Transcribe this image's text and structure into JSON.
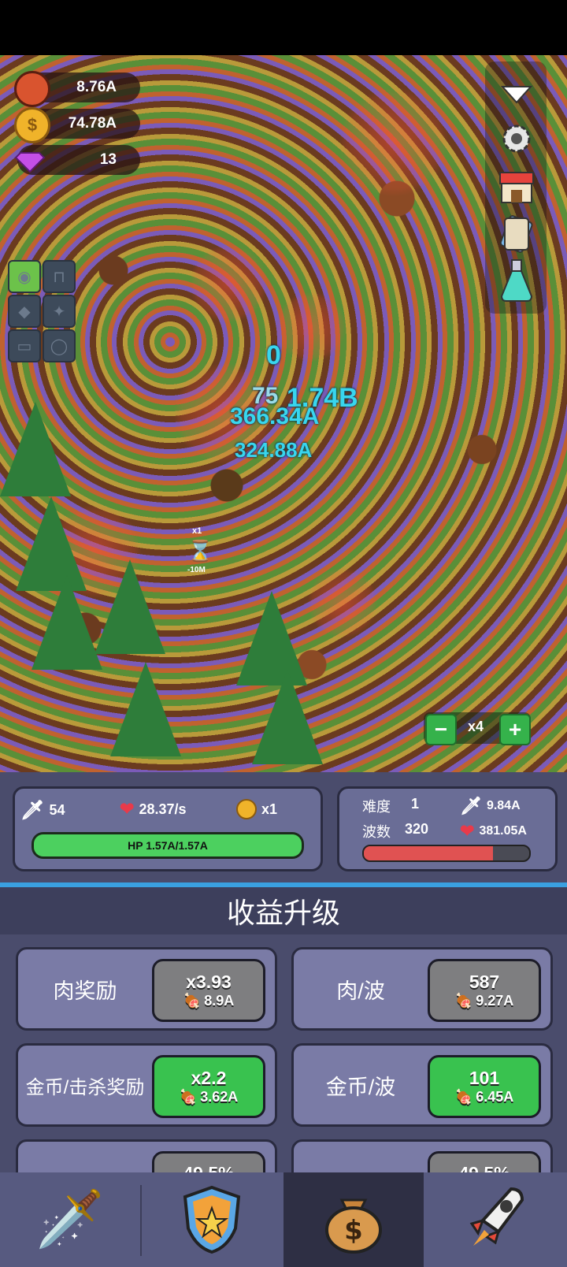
{
  "resources": {
    "meat": "8.76A",
    "gold": "74.78A",
    "gems": "13"
  },
  "floating_numbers": [
    "0",
    "75",
    "1.74B",
    "366.34A",
    "324.88A"
  ],
  "pickup": {
    "multiplier": "x1",
    "value": "-10M"
  },
  "speed": {
    "minus": "−",
    "label": "x4",
    "plus": "+"
  },
  "player_stats": {
    "attack": "54",
    "regen": "28.37/s",
    "gold_mult": "x1",
    "hp_text": "HP 1.57A/1.57A",
    "hp_fraction": 1.0
  },
  "enemy_stats": {
    "difficulty_label": "难度",
    "difficulty": "1",
    "wave_label": "波数",
    "wave": "320",
    "attack": "9.84A",
    "hp": "381.05A",
    "wave_progress": 0.78
  },
  "section_title": "收益升级",
  "upgrades": [
    {
      "label": "肉奖励",
      "top": "x3.93",
      "cost": "8.9A",
      "state": "gray"
    },
    {
      "label": "肉/波",
      "top": "587",
      "cost": "9.27A",
      "state": "gray"
    },
    {
      "label": "金币/击杀奖励",
      "top": "x2.2",
      "cost": "3.62A",
      "state": "green"
    },
    {
      "label": "金币/波",
      "top": "101",
      "cost": "6.45A",
      "state": "green"
    },
    {
      "label": "",
      "top": "49.5%",
      "cost": "",
      "state": "gray"
    },
    {
      "label": "",
      "top": "49.5%",
      "cost": "",
      "state": "gray"
    }
  ],
  "colors": {
    "hp_green": "#4cd05f",
    "enemy_red": "#e05252",
    "accent_blue": "#3aa0e0",
    "panel": "#4a4c6c"
  }
}
